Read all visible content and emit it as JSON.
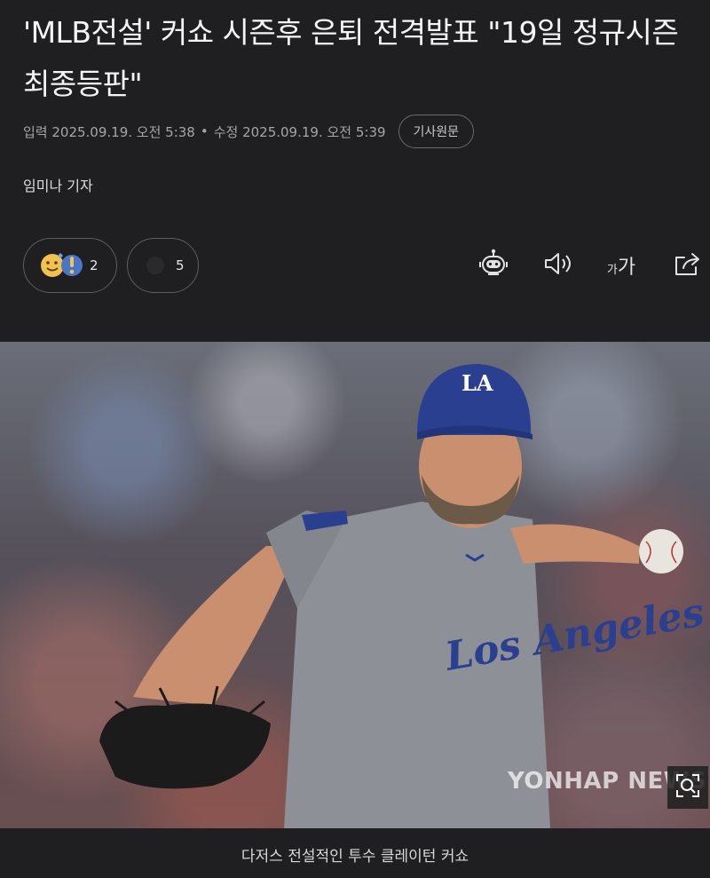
{
  "article": {
    "title": "'MLB전설' 커쇼 시즌후 은퇴 전격발표 \"19일 정규시즌 최종등판\"",
    "published": "입력 2025.09.19. 오전 5:38",
    "separator": "•",
    "modified": "수정 2025.09.19. 오전 5:39",
    "original_link_label": "기사원문",
    "reporter": "임미나 기자"
  },
  "reactions": [
    {
      "icon": "reaction-emoji-icon",
      "count": "2"
    },
    {
      "icon": "comment-icon",
      "count": "5"
    }
  ],
  "toolbar": {
    "summary_icon": "robot-icon",
    "tts_icon": "speaker-icon",
    "font_size_small": "가",
    "font_size_large": "가",
    "share_icon": "share-icon"
  },
  "photo": {
    "watermark": "YONHAP NEWS",
    "jersey_text": "Los Angeles",
    "cap_logo": "LA",
    "caption": "다저스 전설적인 투수 클레이턴 커쇼"
  },
  "colors": {
    "background": "#1f1f21",
    "dodger_blue": "#2a3f8f",
    "jersey_gray": "#8d9096"
  }
}
